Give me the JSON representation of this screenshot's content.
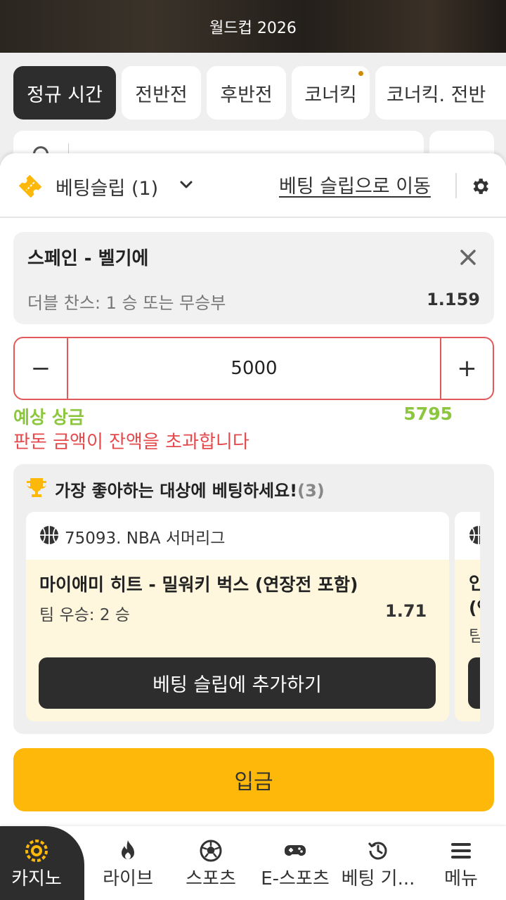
{
  "header": {
    "title": "월드컵 2026"
  },
  "period_tabs": [
    {
      "label": "정규 시간",
      "active": true
    },
    {
      "label": "전반전",
      "active": false
    },
    {
      "label": "후반전",
      "active": false
    },
    {
      "label": "코너킥",
      "active": false,
      "has_dot": true
    },
    {
      "label": "코너킥. 전반",
      "active": false
    }
  ],
  "bet_slip": {
    "title": "베팅슬립 (1)",
    "go_to_slip": "베팅 슬립으로 이동",
    "selection": {
      "match": "스페인 - 벨기에",
      "market": "더블 찬스: 1 승 또는 무승부",
      "odds": "1.159"
    },
    "stake": {
      "value": "5000",
      "minus": "−",
      "plus": "+"
    },
    "potential_win_label": "예상 상금",
    "potential_win_value": "5795",
    "error": "판돈 금액이 잔액을 초과합니다"
  },
  "promo": {
    "title": "가장 좋아하는 대상에 베팅하세요!",
    "count": "(3)",
    "cards": [
      {
        "league": "75093. NBA 서머리그",
        "match": "마이애미 히트 - 밀워키 벅스 (연장전 포함)",
        "market": "팀 우승: 2 승",
        "odds": "1.71",
        "button": "베팅 슬립에 추가하기"
      },
      {
        "match_line1": "인",
        "match_line2": "(연",
        "market": "팀"
      }
    ]
  },
  "deposit_button": "입금",
  "bottom_nav": [
    {
      "label": "카지노",
      "icon": "chip-icon",
      "active": true
    },
    {
      "label": "라이브",
      "icon": "fire-icon",
      "active": false
    },
    {
      "label": "스포츠",
      "icon": "soccer-ball-icon",
      "active": false
    },
    {
      "label": "E-스포츠",
      "icon": "gamepad-icon",
      "active": false
    },
    {
      "label": "베팅 기...",
      "icon": "history-icon",
      "active": false
    },
    {
      "label": "메뉴",
      "icon": "menu-icon",
      "active": false
    }
  ],
  "colors": {
    "accent_yellow": "#fdb809",
    "success_green": "#8cc63f",
    "error_red": "#e5494c",
    "dark": "#2d2d2d"
  }
}
